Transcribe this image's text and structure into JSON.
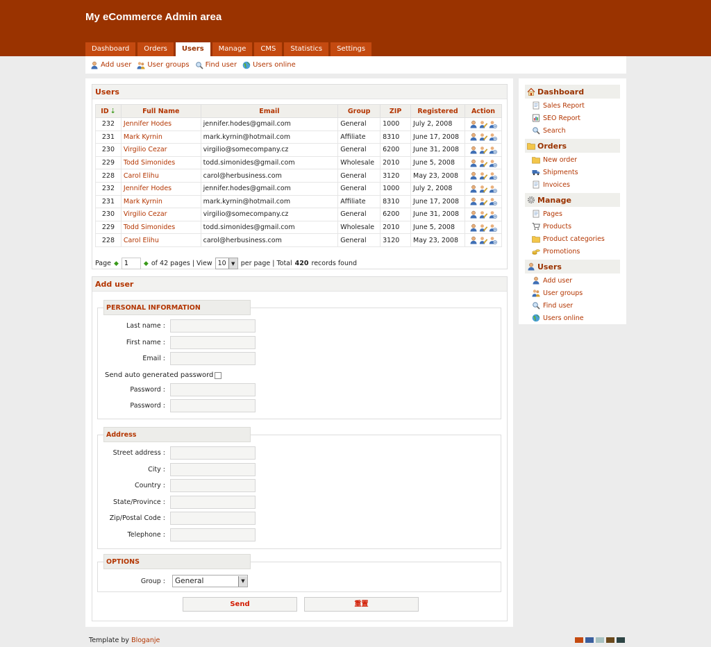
{
  "app": {
    "title": "My eCommerce Admin area"
  },
  "tabs": [
    "Dashboard",
    "Orders",
    "Users",
    "Manage",
    "CMS",
    "Statistics",
    "Settings"
  ],
  "active_tab": "Users",
  "subnav": [
    {
      "label": "Add user",
      "icon": "add-user-icon"
    },
    {
      "label": "User groups",
      "icon": "user-groups-icon"
    },
    {
      "label": "Find user",
      "icon": "find-user-icon"
    },
    {
      "label": "Users online",
      "icon": "users-online-icon"
    }
  ],
  "users": {
    "title": "Users",
    "columns": [
      "ID",
      "Full Name",
      "Email",
      "Group",
      "ZIP",
      "Registered",
      "Action"
    ],
    "sort_indicator": "⇣",
    "rows": [
      [
        "232",
        "Jennifer Hodes",
        "jennifer.hodes@gmail.com",
        "General",
        "1000",
        "July 2, 2008"
      ],
      [
        "231",
        "Mark Kyrnin",
        "mark.kyrnin@hotmail.com",
        "Affiliate",
        "8310",
        "June 17, 2008"
      ],
      [
        "230",
        "Virgilio Cezar",
        "virgilio@somecompany.cz",
        "General",
        "6200",
        "June 31, 2008"
      ],
      [
        "229",
        "Todd Simonides",
        "todd.simonides@gmail.com",
        "Wholesale",
        "2010",
        "June 5, 2008"
      ],
      [
        "228",
        "Carol Elihu",
        "carol@herbusiness.com",
        "General",
        "3120",
        "May 23, 2008"
      ],
      [
        "232",
        "Jennifer Hodes",
        "jennifer.hodes@gmail.com",
        "General",
        "1000",
        "July 2, 2008"
      ],
      [
        "231",
        "Mark Kyrnin",
        "mark.kyrnin@hotmail.com",
        "Affiliate",
        "8310",
        "June 17, 2008"
      ],
      [
        "230",
        "Virgilio Cezar",
        "virgilio@somecompany.cz",
        "General",
        "6200",
        "June 31, 2008"
      ],
      [
        "229",
        "Todd Simonides",
        "todd.simonides@gmail.com",
        "Wholesale",
        "2010",
        "June 5, 2008"
      ],
      [
        "228",
        "Carol Elihu",
        "carol@herbusiness.com",
        "General",
        "3120",
        "May 23, 2008"
      ]
    ],
    "action_icons": [
      "view-user-icon",
      "edit-user-icon",
      "delete-user-icon"
    ]
  },
  "pager": {
    "page_label": "Page",
    "page_value": "1",
    "of_pages": "of 42 pages | View",
    "per_page_value": "10",
    "per_page_label": "per page | Total",
    "total": "420",
    "records_found": "records found"
  },
  "add_user": {
    "title": "Add user",
    "personal": {
      "legend": "PERSONAL INFORMATION",
      "last_name": "Last name :",
      "first_name": "First name :",
      "email": "Email :",
      "auto_password": "Send auto generated password",
      "password": "Password :",
      "password_confirm": "Password :"
    },
    "address": {
      "legend": "Address",
      "fields": [
        "Street address :",
        "City :",
        "Country :",
        "State/Province :",
        "Zip/Postal Code :",
        "Telephone :"
      ]
    },
    "options": {
      "legend": "OPTIONS",
      "group_label": "Group :",
      "group_value": "General"
    },
    "send_button": "Send",
    "reset_button": "重置"
  },
  "sidebar": {
    "sections": [
      {
        "title": "Dashboard",
        "icon": "home-icon",
        "items": [
          {
            "label": "Sales Report",
            "icon": "report-icon"
          },
          {
            "label": "SEO Report",
            "icon": "seo-report-icon"
          },
          {
            "label": "Search",
            "icon": "search-icon"
          }
        ]
      },
      {
        "title": "Orders",
        "icon": "folder-icon",
        "items": [
          {
            "label": "New order",
            "icon": "new-order-icon"
          },
          {
            "label": "Shipments",
            "icon": "truck-icon"
          },
          {
            "label": "Invoices",
            "icon": "invoice-icon"
          }
        ]
      },
      {
        "title": "Manage",
        "icon": "gear-icon",
        "items": [
          {
            "label": "Pages",
            "icon": "page-icon"
          },
          {
            "label": "Products",
            "icon": "cart-icon"
          },
          {
            "label": "Product categories",
            "icon": "category-folder-icon"
          },
          {
            "label": "Promotions",
            "icon": "promotion-icon"
          }
        ]
      },
      {
        "title": "Users",
        "icon": "users-icon",
        "items": [
          {
            "label": "Add user",
            "icon": "add-user-icon"
          },
          {
            "label": "User groups",
            "icon": "user-groups-icon"
          },
          {
            "label": "Find user",
            "icon": "find-user-icon"
          },
          {
            "label": "Users online",
            "icon": "users-online-icon"
          }
        ]
      }
    ]
  },
  "footer": {
    "template_by": "Template by",
    "author": "Bloganje",
    "swatches": [
      "#c44a10",
      "#3b5f9e",
      "#a7c1c0",
      "#6b4a1d",
      "#2d4444"
    ]
  },
  "colors": {
    "header_bg": "#9a3300",
    "tab_bg": "#c44a10",
    "link": "#b33500"
  }
}
